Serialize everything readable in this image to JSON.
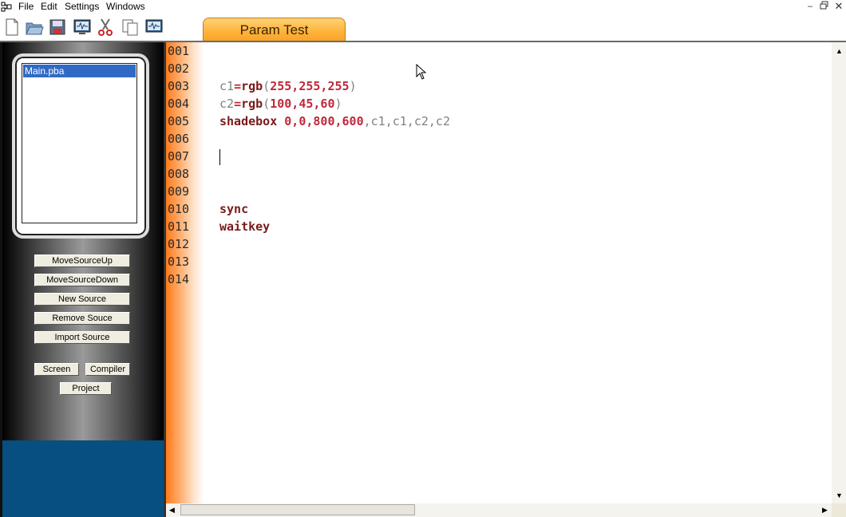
{
  "menu": {
    "items": [
      "File",
      "Edit",
      "Settings",
      "Windows"
    ],
    "window_controls": [
      "minimize-icon",
      "restore-icon",
      "close-icon"
    ]
  },
  "toolbar": {
    "buttons": [
      "new-file-icon",
      "open-folder-icon",
      "save-icon",
      "monitor-icon",
      "cut-icon",
      "copy-icon",
      "run-monitor-icon"
    ]
  },
  "tab": {
    "label": "Param Test"
  },
  "sidebar": {
    "files": [
      "Main.pba"
    ],
    "buttons": {
      "move_up": "MoveSourceUp",
      "move_down": "MoveSourceDown",
      "new_source": "New Source",
      "remove_source": "Remove Souce",
      "import_source": "Import Source",
      "screen": "Screen",
      "compiler": "Compiler",
      "project": "Project"
    }
  },
  "editor": {
    "line_numbers": [
      "001",
      "002",
      "003",
      "004",
      "005",
      "006",
      "007",
      "008",
      "009",
      "010",
      "011",
      "012",
      "013",
      "014"
    ],
    "code": {
      "line3": {
        "var": "c1",
        "op": "=",
        "kw": "rgb",
        "open": "(",
        "args": "255,255,255",
        "close": ")"
      },
      "line4": {
        "var": "c2",
        "op": "=",
        "kw": "rgb",
        "open": "(",
        "args": "100,45,60",
        "close": ")"
      },
      "line5": {
        "kw": "shadebox",
        "args": "0,0,800,600",
        "rest": ",c1,c1,c2,c2"
      },
      "line10": {
        "kw": "sync"
      },
      "line11": {
        "kw": "waitkey"
      }
    }
  },
  "colors": {
    "tab": "#ffb43c",
    "selection": "#316ac5",
    "keyword": "#7a1a1a",
    "number": "#c0283a",
    "sidebar_bottom": "#064f80"
  }
}
